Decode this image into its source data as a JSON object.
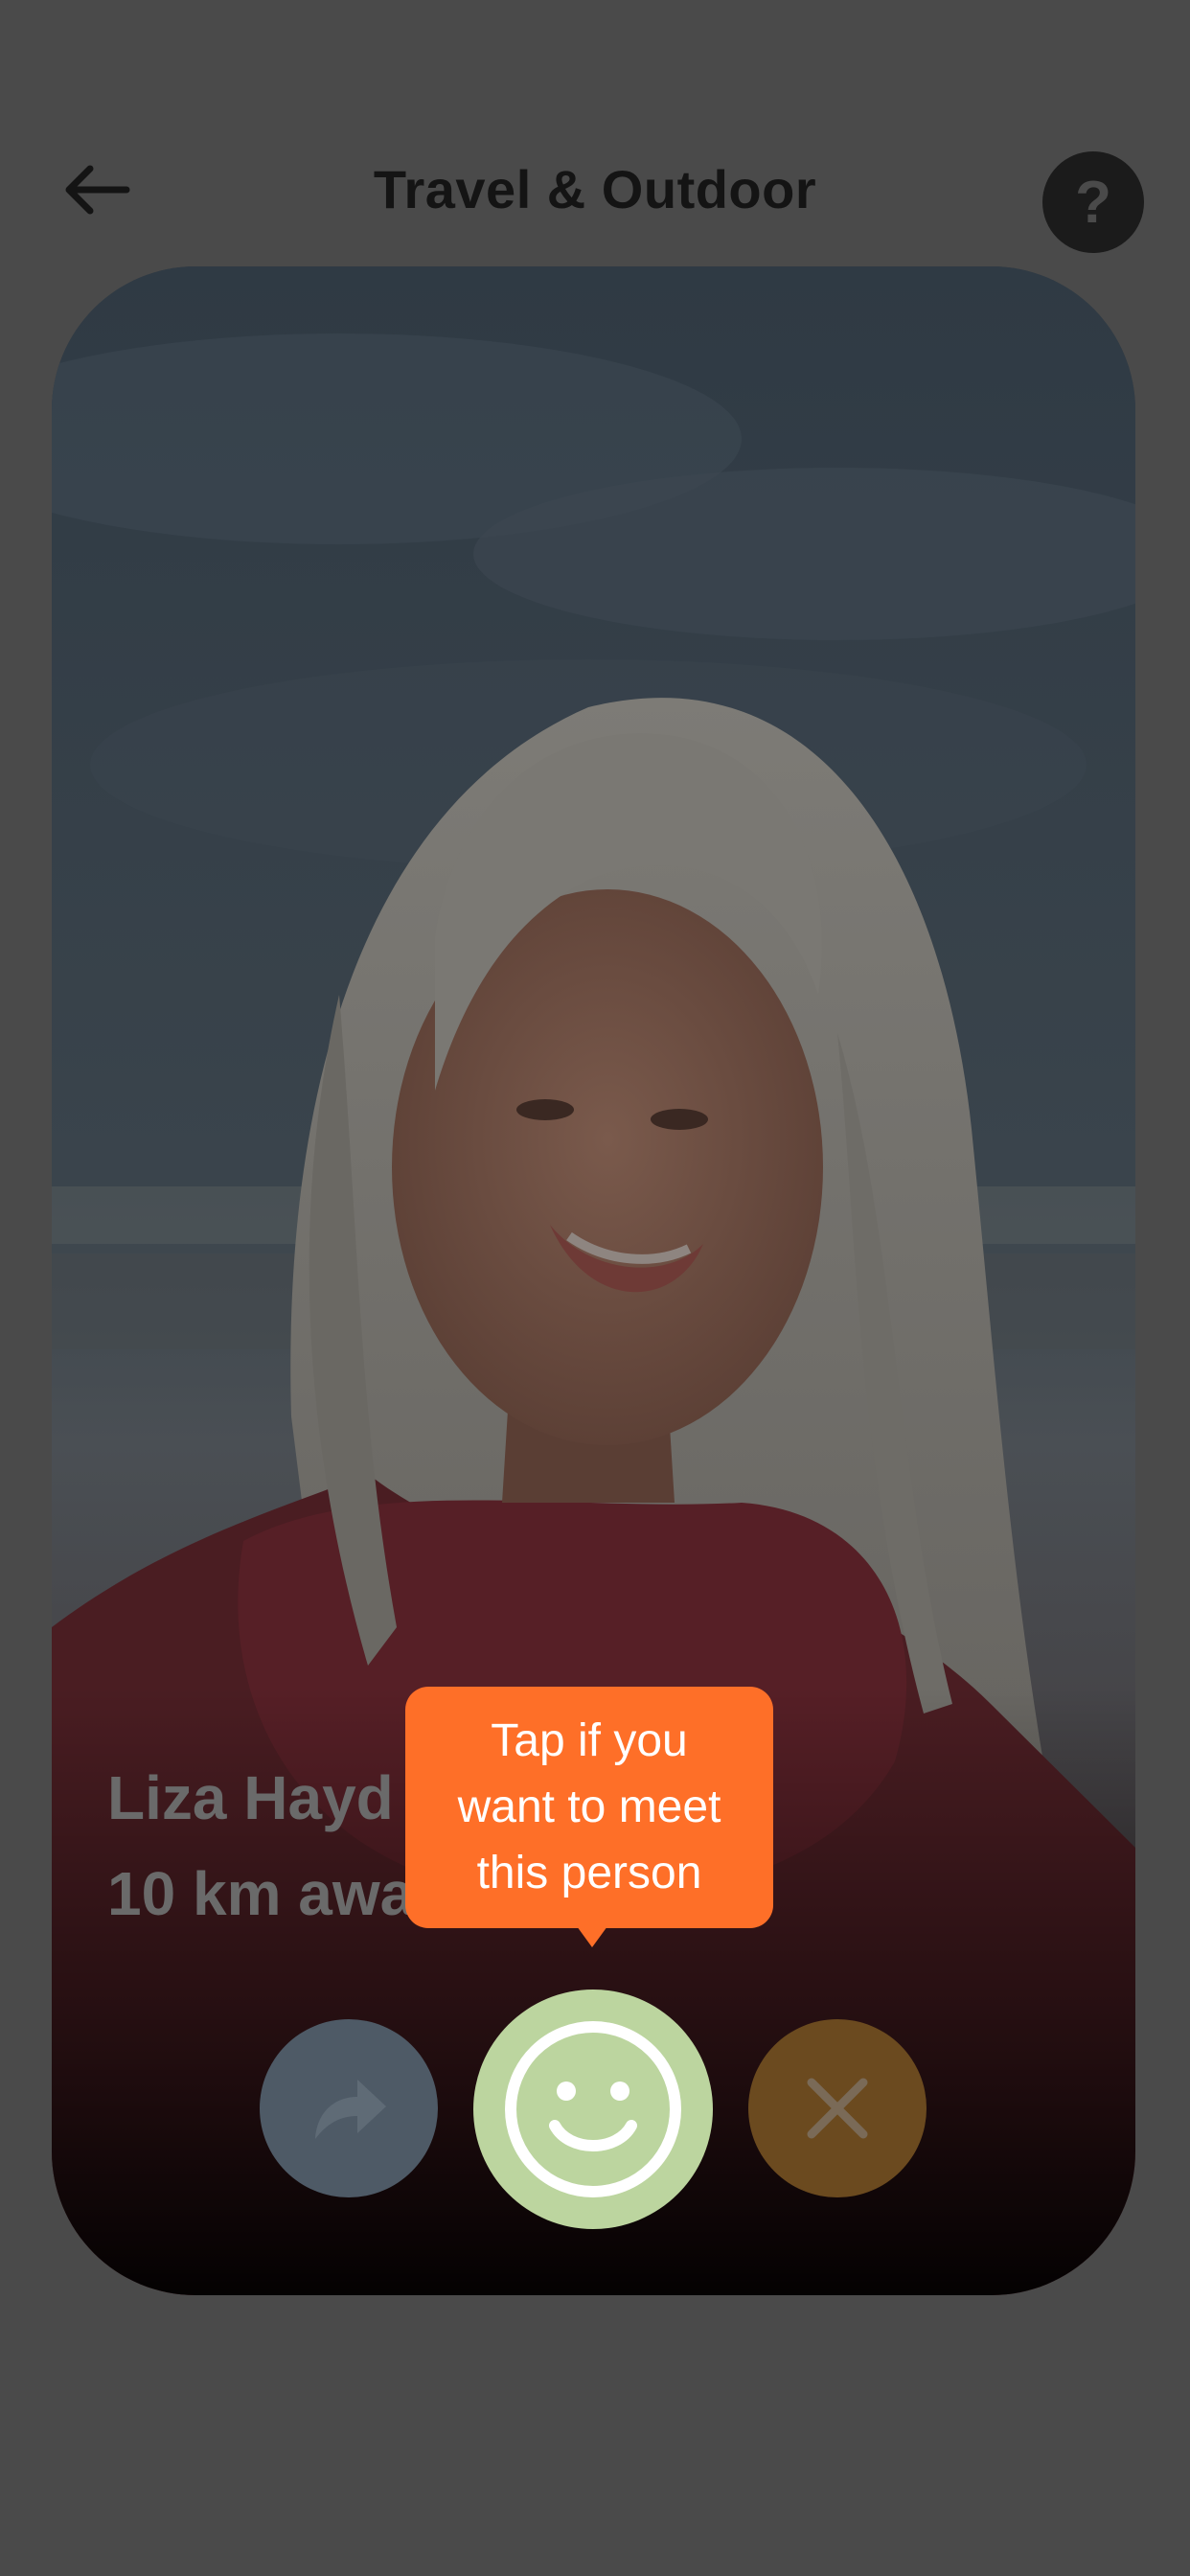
{
  "header": {
    "back_icon": "arrow-left-icon",
    "title": "Travel & Outdoor",
    "help_label": "?",
    "help_icon": "question-mark-icon"
  },
  "profile": {
    "name": "Liza Hayd",
    "distance": "10 km awa"
  },
  "actions": {
    "share_icon": "share-arrow-icon",
    "like_icon": "smiley-face-icon",
    "pass_icon": "close-x-icon"
  },
  "tooltip": {
    "line1": "Tap if you",
    "line2": "want to meet",
    "line3": "this person"
  },
  "colors": {
    "background": "#4a4a4a",
    "tooltip": "#fe6f28",
    "like": "#bcd59f",
    "share": "#4e5a66",
    "pass": "#6b4a1f"
  }
}
